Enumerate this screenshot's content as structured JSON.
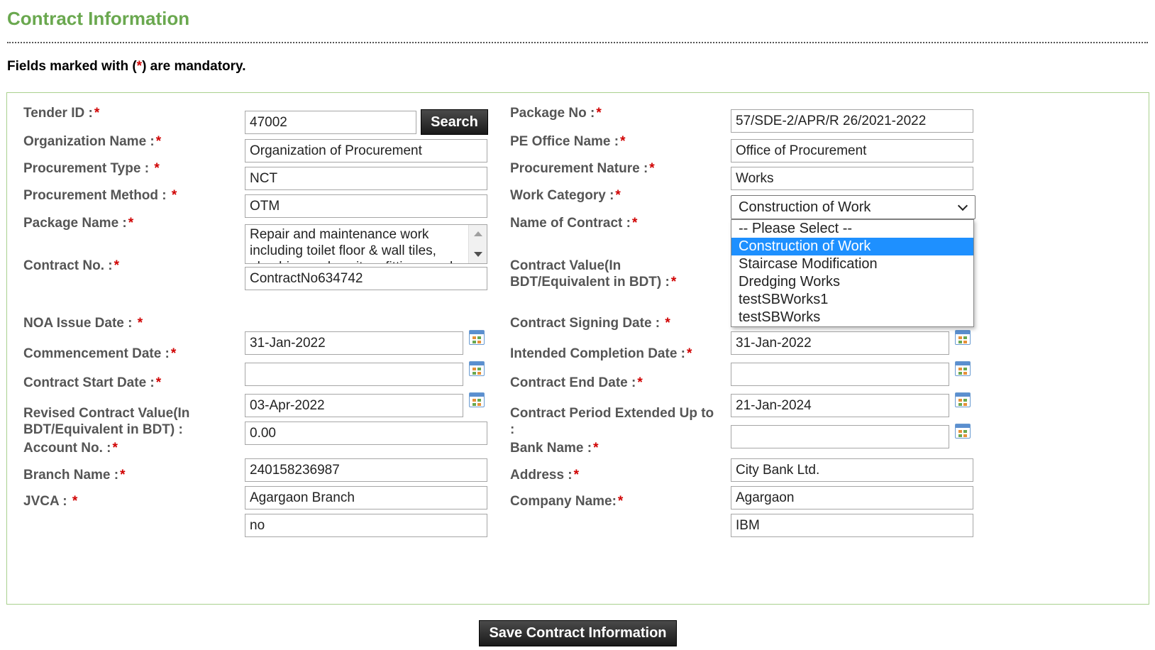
{
  "header": {
    "title": "Contract Information",
    "note_prefix": "Fields marked with (",
    "note_star": "*",
    "note_suffix": ") are mandatory."
  },
  "labels": {
    "tender_id": "Tender ID :",
    "organization_name": "Organization Name :",
    "procurement_type": "Procurement Type : ",
    "procurement_method": "Procurement Method : ",
    "package_name": "Package Name :",
    "contract_no": "Contract No. :",
    "noa_issue_date": "NOA Issue Date : ",
    "commencement_date": "Commencement Date :",
    "contract_start_date": "Contract Start Date :",
    "revised_contract_value_1": "Revised Contract Value(In",
    "revised_contract_value_2": "BDT/Equivalent in BDT) :",
    "account_no": "Account No. :",
    "branch_name": "Branch Name :",
    "jvca": "JVCA : ",
    "package_no": "Package No :",
    "pe_office_name": "PE Office Name :",
    "procurement_nature": "Procurement Nature :",
    "work_category": "Work Category :",
    "name_of_contract": "Name of Contract :",
    "contract_value_1": "Contract Value(In",
    "contract_value_2": "BDT/Equivalent in BDT) :",
    "contract_signing_date": "Contract Signing Date : ",
    "intended_completion_date": "Intended Completion Date :",
    "contract_end_date": "Contract End Date :",
    "contract_period_extended_1": "Contract Period Extended Up to",
    "contract_period_extended_2": ":",
    "bank_name": "Bank Name :",
    "address": "Address :",
    "company_name": "Company Name:",
    "required_star": "*"
  },
  "values": {
    "tender_id": "47002",
    "organization_name": "Organization of Procurement",
    "procurement_type": "NCT",
    "procurement_method": "OTM",
    "package_name": "Repair and maintenance work including toilet floor & wall tiles, plumbing and sanitary fittings work",
    "contract_no": "ContractNo634742",
    "noa_issue_date": "31-Jan-2022",
    "commencement_date": "",
    "contract_start_date": "03-Apr-2022",
    "revised_contract_value": "0.00",
    "account_no": "240158236987",
    "branch_name": "Agargaon Branch",
    "jvca": "no",
    "package_no": "57/SDE-2/APR/R 26/2021-2022",
    "pe_office_name": "Office of Procurement",
    "procurement_nature": "Works",
    "work_category": "Construction of Work",
    "contract_signing_date": "31-Jan-2022",
    "intended_completion_date": "",
    "contract_end_date": "21-Jan-2024",
    "contract_period_extended": "",
    "bank_name": "City Bank Ltd.",
    "address": "Agargaon",
    "company_name": "IBM"
  },
  "work_category_options": [
    "-- Please Select --",
    "Construction of Work",
    "Staircase Modification",
    "Dredging Works",
    "testSBWorks1",
    "testSBWorks"
  ],
  "buttons": {
    "search": "Search",
    "save": "Save Contract Information"
  },
  "icons": {
    "calendar": "calendar-icon",
    "dropdown": "chevron-down-icon"
  },
  "colors": {
    "title": "#6aa84f",
    "required": "#d00000",
    "box_border": "#a9d18e",
    "selected_option": "#1e90ff"
  }
}
